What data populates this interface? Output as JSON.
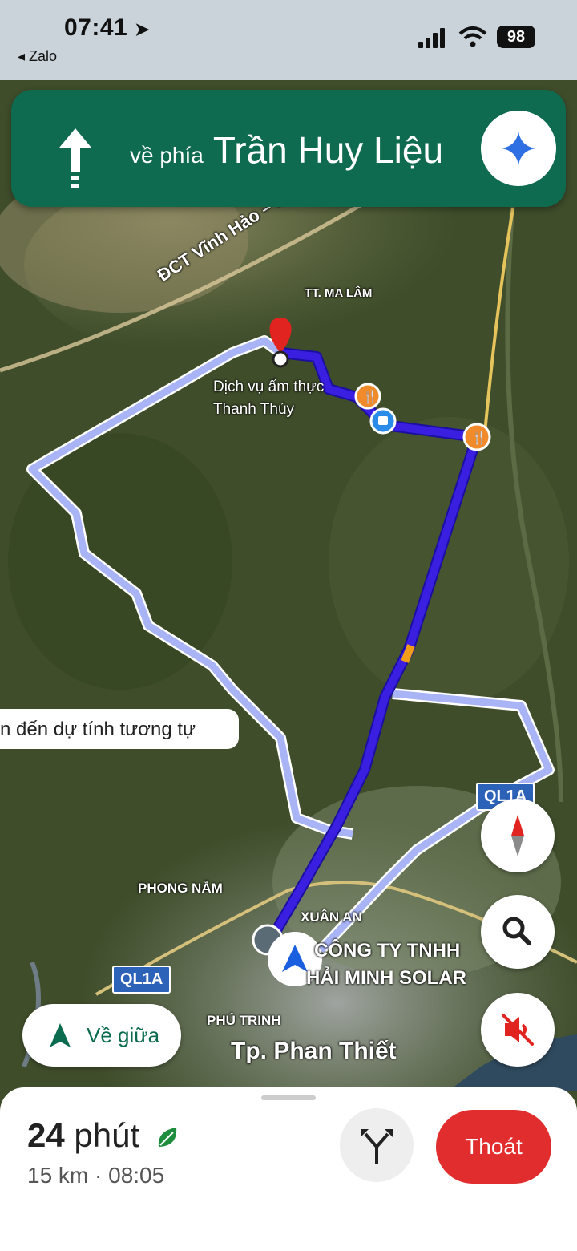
{
  "status_bar": {
    "time": "07:41",
    "back_app": "◂ Zalo",
    "battery": "98"
  },
  "nav_banner": {
    "prefix": "về phía",
    "street": "Trần Huy Liệu",
    "bg_color": "#0f6b4f"
  },
  "map": {
    "road_label_dct": "ĐCT Vĩnh Hảo – Phan Thiết",
    "area_label_ma_lam": "TT. MA LÂM",
    "destination_name_line1": "Dịch vụ ẩm thực",
    "destination_name_line2": "Thanh Thúy",
    "highway_badge_top": "QL1A",
    "highway_badge_bottom": "QL1A",
    "area_label_phong_nam": "PHONG NẪM",
    "area_label_xuan_an": "XUÂN AN",
    "company_line1": "CÔNG TY TNHH",
    "company_line2": "HẢI MINH SOLAR",
    "area_label_phu_trinh": "PHÚ TRINH",
    "city_label": "Tp. Phan Thiết",
    "alt_route_note": "n đến dự tính tương tự",
    "route_color": "#3a1fe0",
    "alt_route_color": "#a8b4f5"
  },
  "controls": {
    "recenter_label": "Về giữa",
    "compass_icon": "compass-icon",
    "search_icon": "search-icon",
    "mute_icon": "volume-muted-icon"
  },
  "trip": {
    "duration_value": "24",
    "duration_unit": "phút",
    "distance_eta": "15 km · 08:05",
    "exit_label": "Thoát",
    "exit_color": "#e12d2d"
  }
}
